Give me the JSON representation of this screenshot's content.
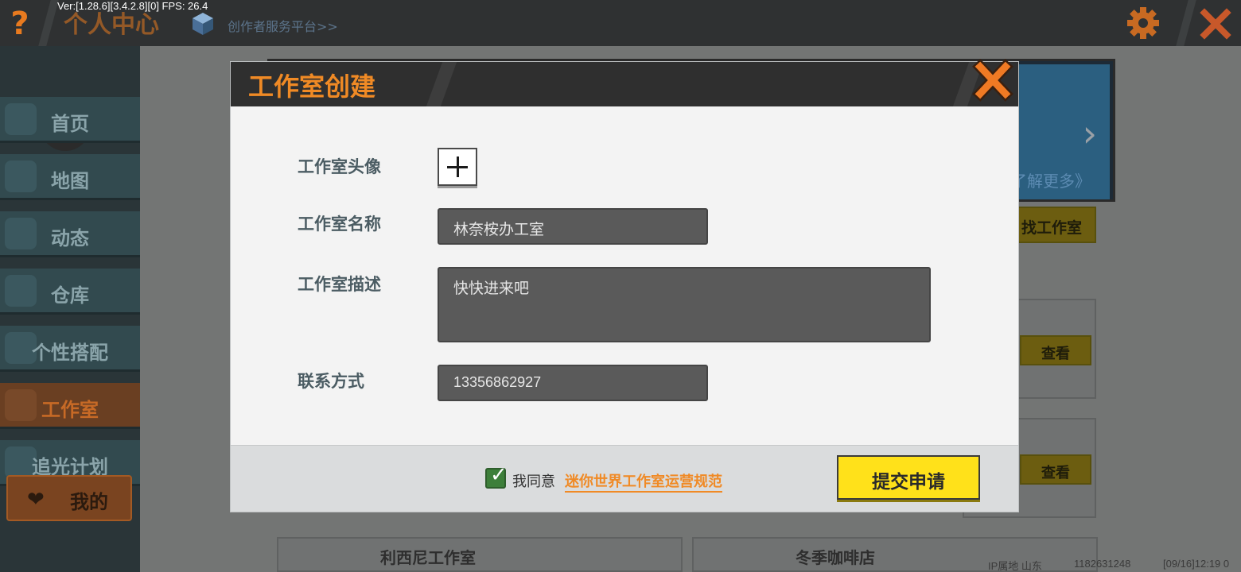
{
  "topbar": {
    "help": "?",
    "title": "个人中心",
    "debug": "Ver:[1.28.6][3.4.2.8][0] FPS: 26.4",
    "creator_link": "创作者服务平台>>"
  },
  "sidebar": {
    "items": [
      {
        "label": "首页"
      },
      {
        "label": "地图"
      },
      {
        "label": "动态"
      },
      {
        "label": "仓库"
      },
      {
        "label": "个性搭配"
      },
      {
        "label": "工作室"
      },
      {
        "label": "追光计划"
      }
    ],
    "active_index": 5,
    "mine_label": "我的",
    "mine_icon": "heart-icon"
  },
  "background": {
    "banner_more": "了解更多》",
    "find_studio": "找工作室",
    "view_label": "查看",
    "card_titles": [
      "利西尼工作室",
      "冬季咖啡店"
    ],
    "footer_ip": "IP属地 山东",
    "footer_id": "1182631248",
    "footer_time": "[09/16]12:19 0"
  },
  "modal": {
    "title": "工作室创建",
    "labels": {
      "avatar": "工作室头像",
      "name": "工作室名称",
      "description": "工作室描述",
      "contact": "联系方式"
    },
    "values": {
      "name": "林奈桉办工室",
      "description": "快快进来吧",
      "contact": "13356862927"
    },
    "agree_text": "我同意",
    "agree_link": "迷你世界工作室运营规范",
    "agree_checked": true,
    "submit_label": "提交申请"
  },
  "colors": {
    "accent_orange": "#f08a25",
    "submit_yellow": "#ffe11a",
    "topbar": "#2f3132",
    "sidebar_active": "#6a3f22"
  }
}
